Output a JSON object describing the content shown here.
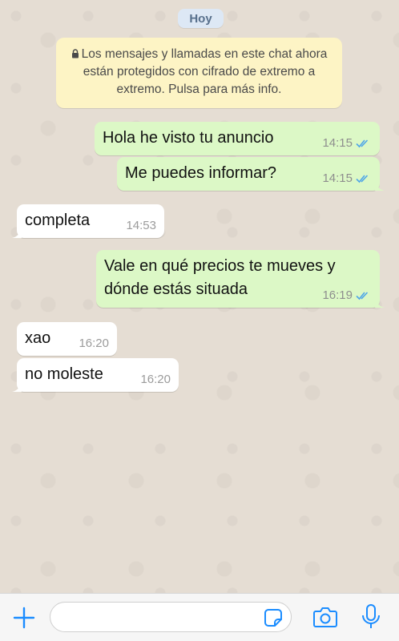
{
  "chat": {
    "day_label": "Hoy",
    "encryption_notice": "Los mensajes y llamadas en este chat ahora están protegidos con cifrado de extremo a extremo. Pulsa para más info.",
    "messages": [
      {
        "direction": "outgoing",
        "lines": [
          "Hola he visto tu anuncio"
        ],
        "time": "14:15",
        "status": "read"
      },
      {
        "direction": "outgoing",
        "lines": [
          "Me puedes informar?"
        ],
        "time": "14:15",
        "status": "read"
      },
      {
        "direction": "incoming",
        "lines": [
          "completa"
        ],
        "time": "14:53"
      },
      {
        "direction": "outgoing",
        "lines": [
          "Vale en qué precios te mueves y",
          "dónde estás situada"
        ],
        "time": "16:19",
        "status": "read"
      },
      {
        "direction": "incoming",
        "lines": [
          "xao"
        ],
        "time": "16:20"
      },
      {
        "direction": "incoming",
        "lines": [
          "no moleste"
        ],
        "time": "16:20"
      }
    ]
  },
  "colors": {
    "outgoing_bubble": "#dcf8c6",
    "incoming_bubble": "#ffffff",
    "read_ticks": "#4fa6e8",
    "accent": "#1a8cff",
    "notice_bg": "#fdf4c5"
  },
  "input_bar": {
    "placeholder": "",
    "icons": [
      "plus-icon",
      "sticker-icon",
      "camera-icon",
      "microphone-icon"
    ]
  }
}
